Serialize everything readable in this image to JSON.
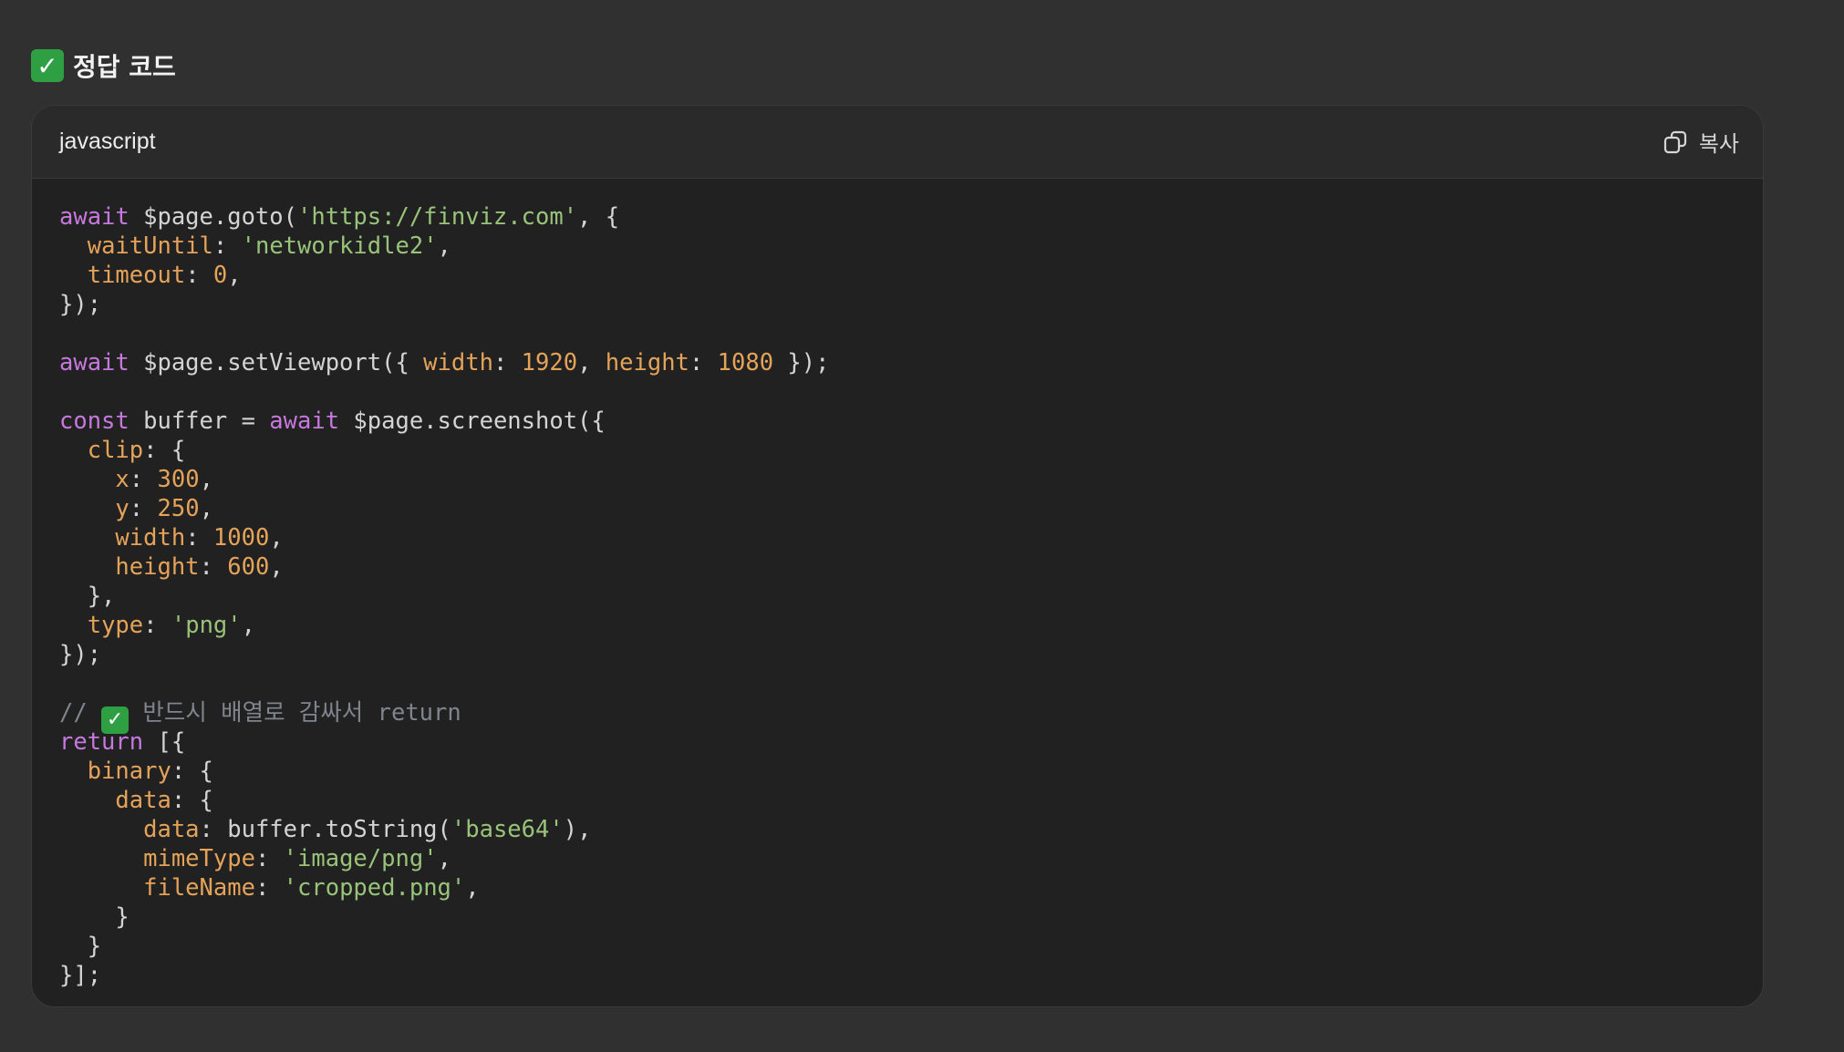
{
  "heading": {
    "check": "✓",
    "title": "정답 코드"
  },
  "code_block": {
    "language": "javascript",
    "copy_label": "복사",
    "lines": [
      [
        [
          "kw",
          "await"
        ],
        [
          "pl",
          " $page.goto("
        ],
        [
          "str",
          "'https://finviz.com'"
        ],
        [
          "pl",
          ", {"
        ]
      ],
      [
        [
          "pl",
          "  "
        ],
        [
          "prop",
          "waitUntil"
        ],
        [
          "pl",
          ": "
        ],
        [
          "str",
          "'networkidle2'"
        ],
        [
          "pl",
          ","
        ]
      ],
      [
        [
          "pl",
          "  "
        ],
        [
          "prop",
          "timeout"
        ],
        [
          "pl",
          ": "
        ],
        [
          "num",
          "0"
        ],
        [
          "pl",
          ","
        ]
      ],
      [
        [
          "pl",
          "});"
        ]
      ],
      [],
      [
        [
          "kw",
          "await"
        ],
        [
          "pl",
          " $page.setViewport({ "
        ],
        [
          "prop",
          "width"
        ],
        [
          "pl",
          ": "
        ],
        [
          "num",
          "1920"
        ],
        [
          "pl",
          ", "
        ],
        [
          "prop",
          "height"
        ],
        [
          "pl",
          ": "
        ],
        [
          "num",
          "1080"
        ],
        [
          "pl",
          " });"
        ]
      ],
      [],
      [
        [
          "kw",
          "const"
        ],
        [
          "pl",
          " buffer = "
        ],
        [
          "kw",
          "await"
        ],
        [
          "pl",
          " $page.screenshot({"
        ]
      ],
      [
        [
          "pl",
          "  "
        ],
        [
          "prop",
          "clip"
        ],
        [
          "pl",
          ": {"
        ]
      ],
      [
        [
          "pl",
          "    "
        ],
        [
          "prop",
          "x"
        ],
        [
          "pl",
          ": "
        ],
        [
          "num",
          "300"
        ],
        [
          "pl",
          ","
        ]
      ],
      [
        [
          "pl",
          "    "
        ],
        [
          "prop",
          "y"
        ],
        [
          "pl",
          ": "
        ],
        [
          "num",
          "250"
        ],
        [
          "pl",
          ","
        ]
      ],
      [
        [
          "pl",
          "    "
        ],
        [
          "prop",
          "width"
        ],
        [
          "pl",
          ": "
        ],
        [
          "num",
          "1000"
        ],
        [
          "pl",
          ","
        ]
      ],
      [
        [
          "pl",
          "    "
        ],
        [
          "prop",
          "height"
        ],
        [
          "pl",
          ": "
        ],
        [
          "num",
          "600"
        ],
        [
          "pl",
          ","
        ]
      ],
      [
        [
          "pl",
          "  },"
        ]
      ],
      [
        [
          "pl",
          "  "
        ],
        [
          "prop",
          "type"
        ],
        [
          "pl",
          ": "
        ],
        [
          "str",
          "'png'"
        ],
        [
          "pl",
          ","
        ]
      ],
      [
        [
          "pl",
          "});"
        ]
      ],
      [],
      [
        [
          "cm",
          "// "
        ],
        [
          "check",
          "✓"
        ],
        [
          "cm",
          " 반드시 배열로 감싸서 return"
        ]
      ],
      [
        [
          "kw",
          "return"
        ],
        [
          "pl",
          " [{"
        ]
      ],
      [
        [
          "pl",
          "  "
        ],
        [
          "prop",
          "binary"
        ],
        [
          "pl",
          ": {"
        ]
      ],
      [
        [
          "pl",
          "    "
        ],
        [
          "prop",
          "data"
        ],
        [
          "pl",
          ": {"
        ]
      ],
      [
        [
          "pl",
          "      "
        ],
        [
          "prop",
          "data"
        ],
        [
          "pl",
          ": buffer.toString("
        ],
        [
          "str",
          "'base64'"
        ],
        [
          "pl",
          "),"
        ]
      ],
      [
        [
          "pl",
          "      "
        ],
        [
          "prop",
          "mimeType"
        ],
        [
          "pl",
          ": "
        ],
        [
          "str",
          "'image/png'"
        ],
        [
          "pl",
          ","
        ]
      ],
      [
        [
          "pl",
          "      "
        ],
        [
          "prop",
          "fileName"
        ],
        [
          "pl",
          ": "
        ],
        [
          "str",
          "'cropped.png'"
        ],
        [
          "pl",
          ","
        ]
      ],
      [
        [
          "pl",
          "    }"
        ]
      ],
      [
        [
          "pl",
          "  }"
        ]
      ],
      [
        [
          "pl",
          "}];"
        ]
      ]
    ]
  }
}
